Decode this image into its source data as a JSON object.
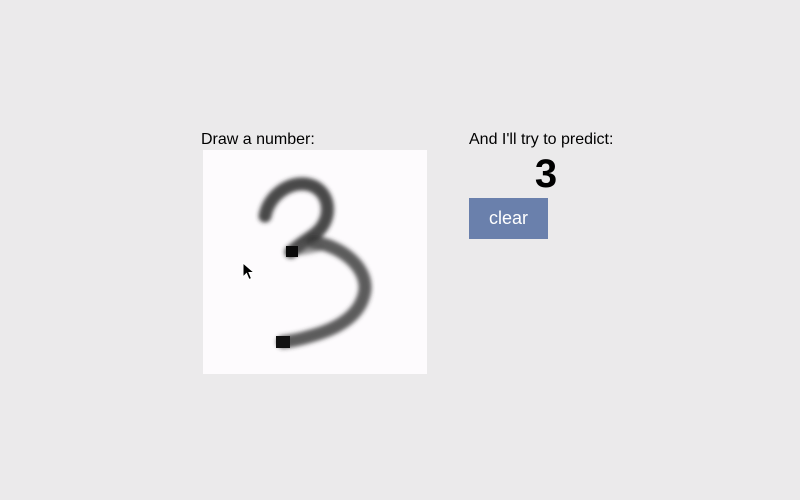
{
  "draw_panel": {
    "label": "Draw a number:",
    "canvas_icon": "handwritten-digit-stroke"
  },
  "predict_panel": {
    "label": "And I'll try to predict:",
    "prediction": "3",
    "clear_label": "clear"
  },
  "colors": {
    "background": "#ebeaeb",
    "canvas": "#fdfbfd",
    "button": "#6a80ac",
    "button_text": "#ffffff",
    "ink": "#1a1a1a"
  },
  "cursor_icon": "mouse-pointer-icon"
}
